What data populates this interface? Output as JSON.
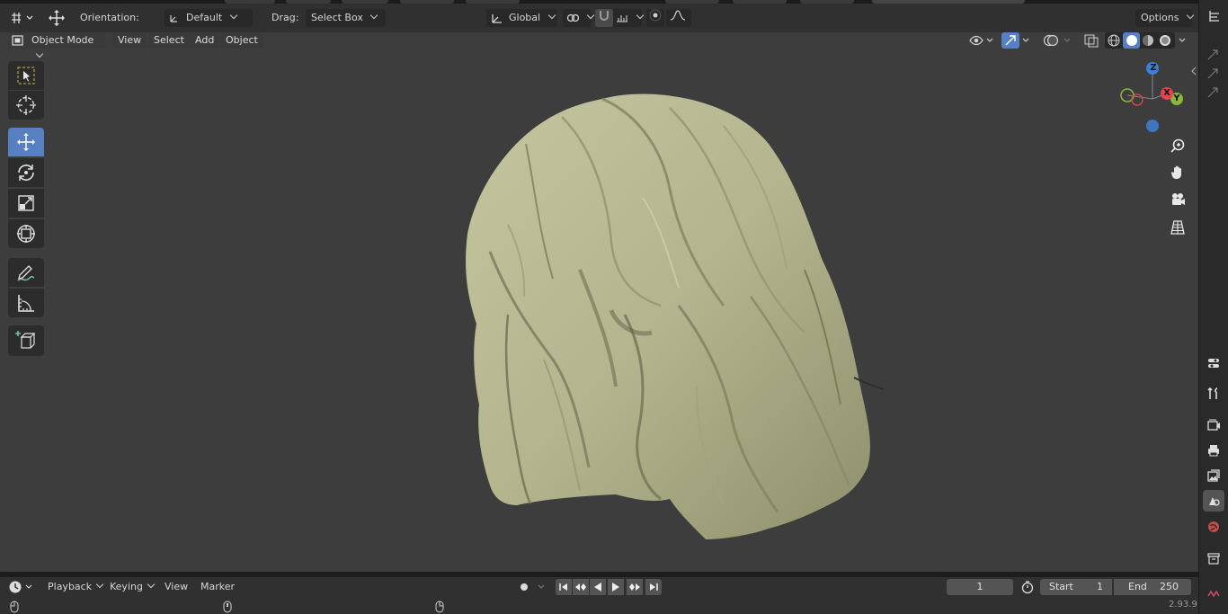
{
  "header": {
    "orientation_label": "Orientation:",
    "orientation_value": "Default",
    "drag_label": "Drag:",
    "drag_value": "Select Box",
    "transform_space": "Global",
    "options_label": "Options"
  },
  "viewport_header": {
    "mode": "Object Mode",
    "menus": [
      "View",
      "Select",
      "Add",
      "Object"
    ]
  },
  "toolbar": {
    "tools": [
      "select-box",
      "cursor",
      "move",
      "rotate",
      "scale",
      "transform",
      "annotate",
      "measure",
      "add-cube"
    ],
    "active_tool": "move"
  },
  "gizmo": {
    "z": "Z",
    "x": "X",
    "y": "Y"
  },
  "timeline": {
    "menus": [
      "Playback",
      "Keying",
      "View",
      "Marker"
    ],
    "current_frame": "1",
    "start_label": "Start",
    "start_value": "1",
    "end_label": "End",
    "end_value": "250"
  },
  "status": {
    "version": "2.93.9"
  },
  "colors": {
    "viewport_bg": "#3d3d3d",
    "header_bg": "#303030",
    "accent": "#5680c2",
    "hair": "#b9bb95",
    "axis_x": "#e84150",
    "axis_y": "#8ab83a",
    "axis_z": "#3d7fd6"
  }
}
